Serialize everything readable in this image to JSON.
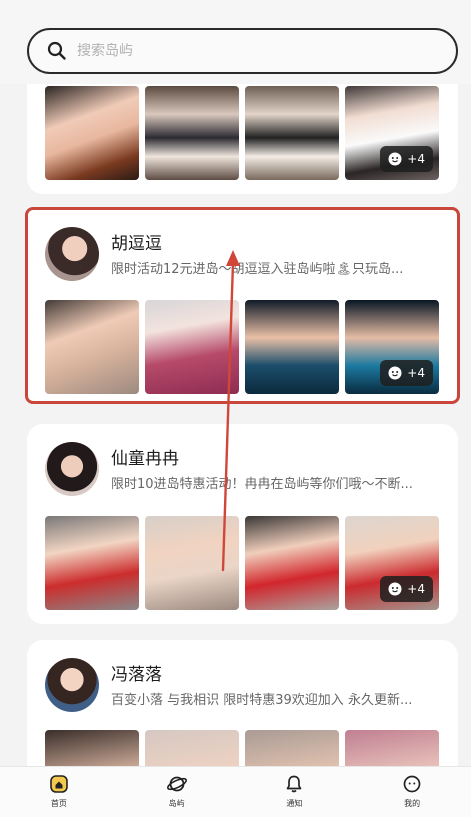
{
  "search": {
    "placeholder": "搜索岛屿"
  },
  "cards": [
    {
      "more_label": "+4"
    },
    {
      "name": "胡逗逗",
      "desc": "限时活动12元进岛～胡逗逗入驻岛屿啦🏝只玩岛...",
      "more_label": "+4",
      "highlighted": true
    },
    {
      "name": "仙童冉冉",
      "desc": "限时10进岛特惠活动！冉冉在岛屿等你们哦～不断...",
      "more_label": "+4"
    },
    {
      "name": "冯落落",
      "desc": "百变小落 与我相识 限时特惠39欢迎加入 永久更新..."
    }
  ],
  "tabbar": {
    "items": [
      {
        "label": "首页",
        "icon": "home-icon",
        "active": true
      },
      {
        "label": "岛屿",
        "icon": "planet-icon"
      },
      {
        "label": "通知",
        "icon": "bell-icon"
      },
      {
        "label": "我的",
        "icon": "profile-icon"
      }
    ]
  },
  "colors": {
    "highlight": "#c8463a",
    "active_tab": "#f2c94c"
  }
}
